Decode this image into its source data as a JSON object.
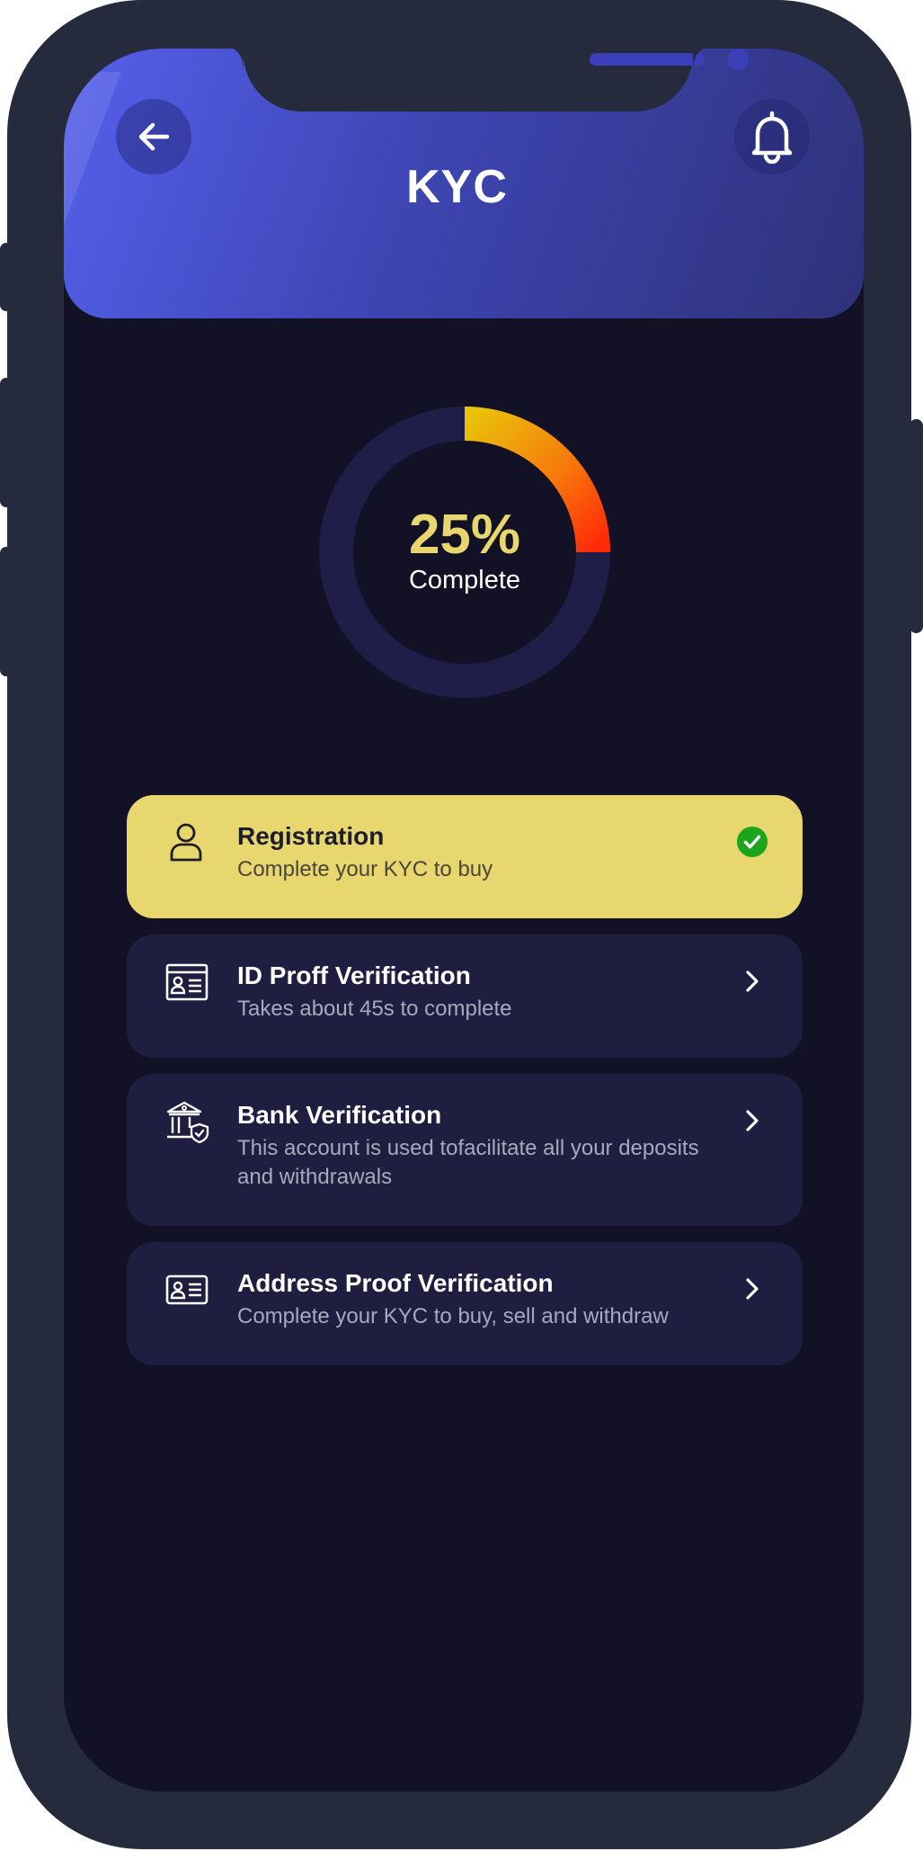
{
  "header": {
    "title": "KYC",
    "back_icon": "arrow-left-icon",
    "notification_icon": "bell-icon",
    "gradient": [
      "#5560ec",
      "#2f3279"
    ]
  },
  "progress": {
    "percent": 25,
    "value_text": "25%",
    "label": "Complete",
    "track_color": "#201e48",
    "arc_colors": [
      "#e9c20a",
      "#f77a0c",
      "#ff2a08"
    ]
  },
  "steps": [
    {
      "title": "Registration",
      "subtitle": "Complete your KYC to buy",
      "icon": "user-icon",
      "status": "completed",
      "status_icon": "check-circle-icon"
    },
    {
      "title": "ID Proff Verification",
      "subtitle": "Takes about 45s to complete",
      "icon": "id-card-icon",
      "status": "pending",
      "status_icon": "chevron-right-icon"
    },
    {
      "title": "Bank Verification",
      "subtitle": "This account is used tofacilitate all your deposits and withdrawals",
      "icon": "bank-shield-icon",
      "status": "pending",
      "status_icon": "chevron-right-icon"
    },
    {
      "title": "Address Proof Verification",
      "subtitle": "Complete your KYC to buy, sell and withdraw",
      "icon": "address-card-icon",
      "status": "pending",
      "status_icon": "chevron-right-icon"
    }
  ],
  "colors": {
    "background": "#121126",
    "card": "#1f1d40",
    "card_completed": "#e8d66e",
    "accent_yellow": "#e8d66e",
    "success": "#1aa51a",
    "device_frame": "#262a3d"
  }
}
